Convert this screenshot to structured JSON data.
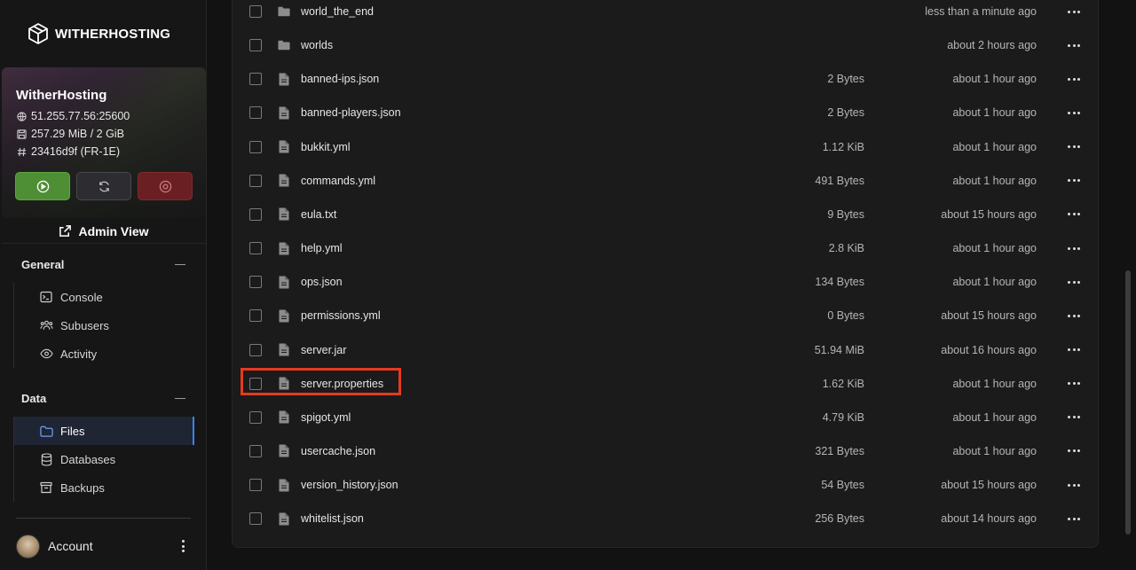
{
  "brand": {
    "name": "WITHERHOSTING"
  },
  "server": {
    "name": "WitherHosting",
    "address": "51.255.77.56:25600",
    "memory": "257.29 MiB / 2 GiB",
    "id": "23416d9f (FR-1E)"
  },
  "admin_view": {
    "label": "Admin View"
  },
  "nav": {
    "general": {
      "title": "General",
      "items": [
        {
          "label": "Console",
          "icon": "terminal-icon"
        },
        {
          "label": "Subusers",
          "icon": "users-icon"
        },
        {
          "label": "Activity",
          "icon": "eye-icon"
        }
      ]
    },
    "data": {
      "title": "Data",
      "items": [
        {
          "label": "Files",
          "icon": "folder-icon",
          "active": true
        },
        {
          "label": "Databases",
          "icon": "database-icon"
        },
        {
          "label": "Backups",
          "icon": "archive-icon"
        }
      ]
    }
  },
  "account": {
    "label": "Account"
  },
  "files": [
    {
      "name": "world_the_end",
      "type": "folder",
      "size": "",
      "modified": "less than a minute ago"
    },
    {
      "name": "worlds",
      "type": "folder",
      "size": "",
      "modified": "about 2 hours ago"
    },
    {
      "name": "banned-ips.json",
      "type": "file",
      "size": "2 Bytes",
      "modified": "about 1 hour ago"
    },
    {
      "name": "banned-players.json",
      "type": "file",
      "size": "2 Bytes",
      "modified": "about 1 hour ago"
    },
    {
      "name": "bukkit.yml",
      "type": "file",
      "size": "1.12 KiB",
      "modified": "about 1 hour ago"
    },
    {
      "name": "commands.yml",
      "type": "file",
      "size": "491 Bytes",
      "modified": "about 1 hour ago"
    },
    {
      "name": "eula.txt",
      "type": "file",
      "size": "9 Bytes",
      "modified": "about 15 hours ago"
    },
    {
      "name": "help.yml",
      "type": "file",
      "size": "2.8 KiB",
      "modified": "about 1 hour ago"
    },
    {
      "name": "ops.json",
      "type": "file",
      "size": "134 Bytes",
      "modified": "about 1 hour ago"
    },
    {
      "name": "permissions.yml",
      "type": "file",
      "size": "0 Bytes",
      "modified": "about 15 hours ago"
    },
    {
      "name": "server.jar",
      "type": "file",
      "size": "51.94 MiB",
      "modified": "about 16 hours ago"
    },
    {
      "name": "server.properties",
      "type": "file",
      "size": "1.62 KiB",
      "modified": "about 1 hour ago",
      "highlighted": true
    },
    {
      "name": "spigot.yml",
      "type": "file",
      "size": "4.79 KiB",
      "modified": "about 1 hour ago"
    },
    {
      "name": "usercache.json",
      "type": "file",
      "size": "321 Bytes",
      "modified": "about 1 hour ago"
    },
    {
      "name": "version_history.json",
      "type": "file",
      "size": "54 Bytes",
      "modified": "about 15 hours ago"
    },
    {
      "name": "whitelist.json",
      "type": "file",
      "size": "256 Bytes",
      "modified": "about 14 hours ago"
    }
  ],
  "colors": {
    "accent": "#3b82f6",
    "start": "#4e8f35",
    "stop": "#6a1f22",
    "highlight": "#e53a20"
  }
}
